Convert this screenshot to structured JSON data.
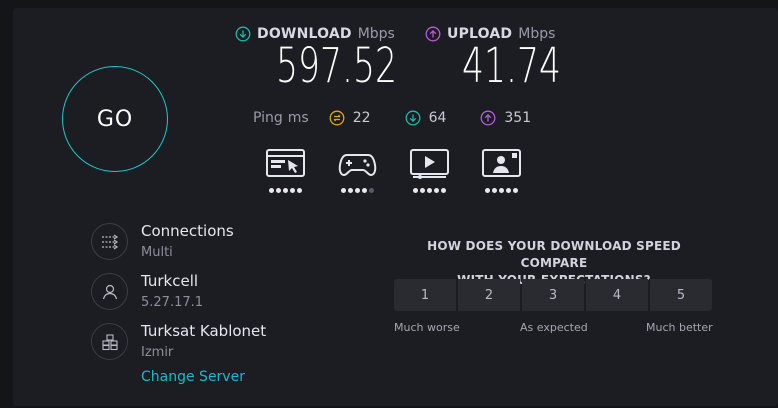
{
  "go_label": "GO",
  "download": {
    "label": "DOWNLOAD",
    "unit": "Mbps",
    "value": "597.52"
  },
  "upload": {
    "label": "UPLOAD",
    "unit": "Mbps",
    "value": "41.74"
  },
  "ping": {
    "label": "Ping",
    "unit": "ms",
    "idle": "22",
    "download": "64",
    "upload": "351"
  },
  "categories": [
    {
      "icon": "web-browsing-icon",
      "rating": 5,
      "max": 5
    },
    {
      "icon": "gaming-icon",
      "rating": 4,
      "max": 5
    },
    {
      "icon": "video-streaming-icon",
      "rating": 5,
      "max": 5
    },
    {
      "icon": "video-chat-icon",
      "rating": 5,
      "max": 5
    }
  ],
  "connections": {
    "title": "Connections",
    "value": "Multi"
  },
  "isp": {
    "name": "Turkcell",
    "ip": "5.27.17.1"
  },
  "server": {
    "name": "Turksat Kablonet",
    "location": "Izmir",
    "change_label": "Change Server"
  },
  "survey": {
    "question_line1": "HOW DOES YOUR DOWNLOAD SPEED COMPARE",
    "question_line2": "WITH YOUR EXPECTATIONS?",
    "options": [
      "1",
      "2",
      "3",
      "4",
      "5"
    ],
    "low_label": "Much worse",
    "mid_label": "As expected",
    "high_label": "Much better"
  },
  "colors": {
    "accent": "#1fb8c9",
    "go_ring": "#21c7c7",
    "download": "#1fb8a8",
    "upload": "#b15fd6",
    "ping_idle": "#e0a41f"
  }
}
